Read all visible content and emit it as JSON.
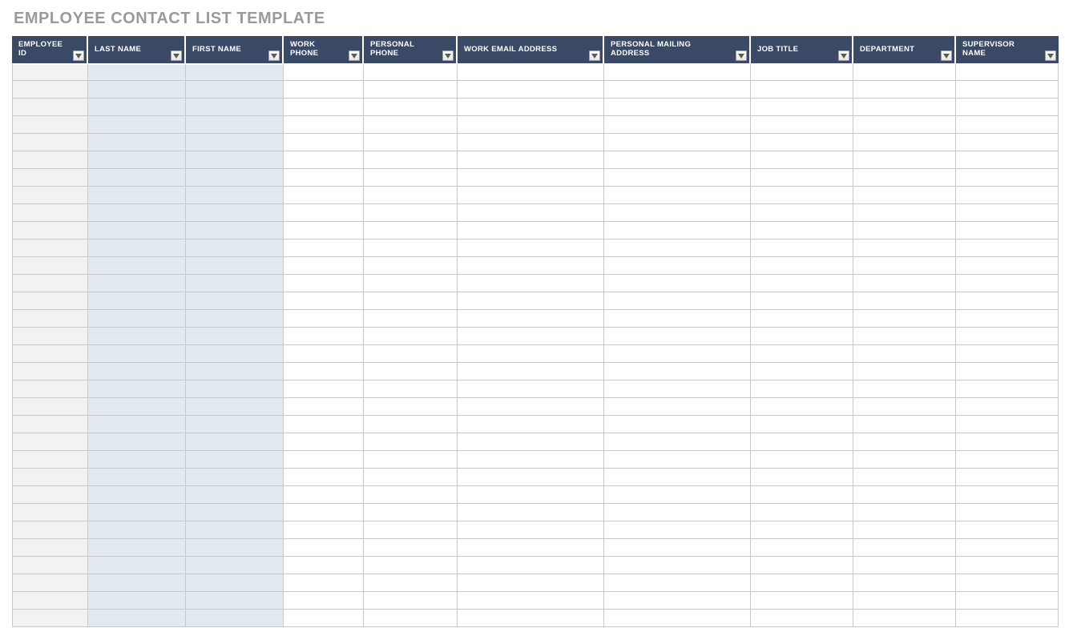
{
  "title": "EMPLOYEE CONTACT LIST TEMPLATE",
  "columns": [
    {
      "label": "EMPLOYEE ID",
      "width": 95
    },
    {
      "label": "LAST NAME",
      "width": 122
    },
    {
      "label": "FIRST NAME",
      "width": 122
    },
    {
      "label": "WORK PHONE",
      "width": 100
    },
    {
      "label": "PERSONAL PHONE",
      "width": 117
    },
    {
      "label": "WORK EMAIL ADDRESS",
      "width": 183
    },
    {
      "label": "PERSONAL MAILING ADDRESS",
      "width": 183
    },
    {
      "label": "JOB TITLE",
      "width": 128
    },
    {
      "label": "DEPARTMENT",
      "width": 128
    },
    {
      "label": "SUPERVISOR NAME",
      "width": 128
    }
  ],
  "row_count": 32,
  "shaded_cols": {
    "0": "shade-a",
    "1": "shade-b",
    "2": "shade-b"
  },
  "colors": {
    "header_bg": "#3a4a66",
    "shade_a": "#f2f2f2",
    "shade_b": "#e3e9f0",
    "title": "#9a9a9a"
  }
}
